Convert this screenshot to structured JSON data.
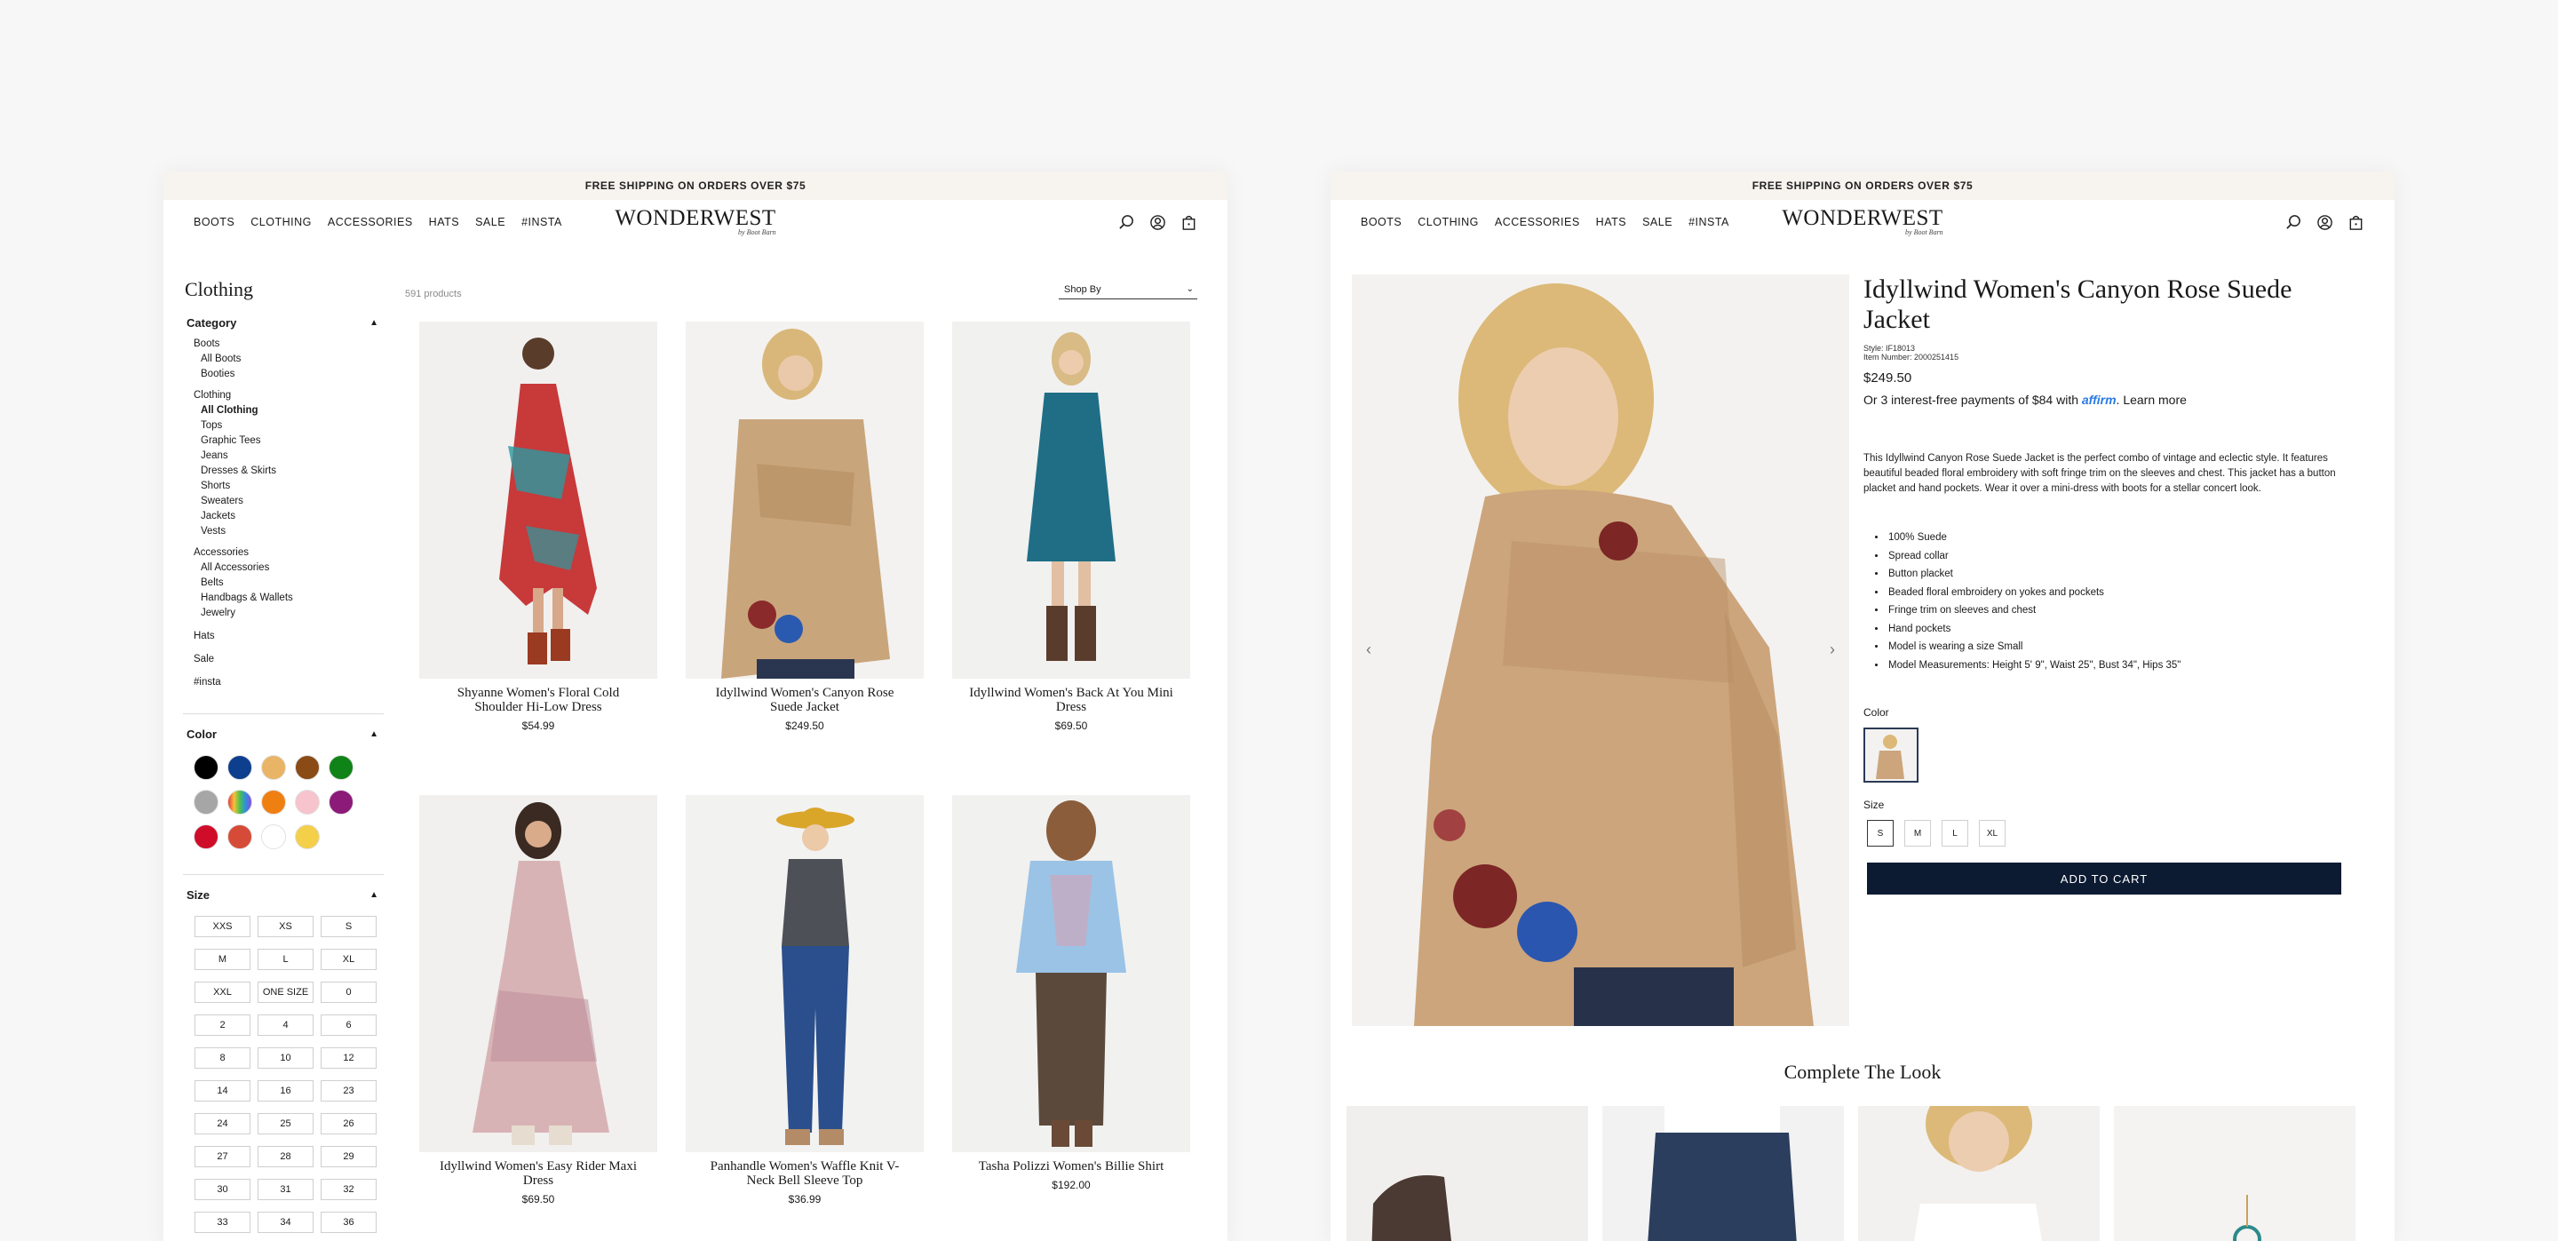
{
  "banner": "FREE SHIPPING ON ORDERS OVER $75",
  "nav": [
    "BOOTS",
    "CLOTHING",
    "ACCESSORIES",
    "HATS",
    "SALE",
    "#INSTA"
  ],
  "logo": {
    "main": "WONDERWEST",
    "sub": "by Boot Barn"
  },
  "icons": [
    "search-icon",
    "account-icon",
    "cart-icon"
  ],
  "listing": {
    "title": "Clothing",
    "count": "591 products",
    "sort_label": "Shop By",
    "category_label": "Category",
    "color_label": "Color",
    "size_label": "Size",
    "categories": {
      "boots": {
        "label": "Boots",
        "items": [
          "All Boots",
          "Booties"
        ]
      },
      "clothing": {
        "label": "Clothing",
        "items": [
          "All Clothing",
          "Tops",
          "Graphic Tees",
          "Jeans",
          "Dresses & Skirts",
          "Shorts",
          "Sweaters",
          "Jackets",
          "Vests"
        ]
      },
      "accessories": {
        "label": "Accessories",
        "items": [
          "All Accessories",
          "Belts",
          "Handbags & Wallets",
          "Jewelry"
        ]
      },
      "hats": "Hats",
      "sale": "Sale",
      "insta": "#insta"
    },
    "colors": [
      "#000000",
      "#0e3f8e",
      "#e9b466",
      "#8a4b16",
      "#108318",
      "#a6a6a6",
      "rainbow",
      "#f07f12",
      "#f7c3cc",
      "#8c1a78",
      "#cf0d2b",
      "#d64b37",
      "#ffffff",
      "#f4cf4a"
    ],
    "sizes": [
      "XXS",
      "XS",
      "S",
      "M",
      "L",
      "XL",
      "XXL",
      "ONE SIZE",
      "0",
      "2",
      "4",
      "6",
      "8",
      "10",
      "12",
      "14",
      "16",
      "23",
      "24",
      "25",
      "26",
      "27",
      "28",
      "29",
      "30",
      "31",
      "32",
      "33",
      "34",
      "36"
    ],
    "products": [
      {
        "name": "Shyanne Women's Floral Cold Shoulder Hi-Low Dress",
        "price": "$54.99"
      },
      {
        "name": "Idyllwind Women's Canyon Rose Suede Jacket",
        "price": "$249.50"
      },
      {
        "name": "Idyllwind Women's Back At You Mini Dress",
        "price": "$69.50"
      },
      {
        "name": "Idyllwind Women's Easy Rider Maxi Dress",
        "price": "$69.50"
      },
      {
        "name": "Panhandle Women's Waffle Knit V-Neck Bell Sleeve Top",
        "price": "$36.99"
      },
      {
        "name": "Tasha Polizzi Women's Billie Shirt",
        "price": "$192.00"
      }
    ]
  },
  "pdp": {
    "title": "Idyllwind Women's Canyon Rose Suede Jacket",
    "style": "Style: IF18013",
    "item_number": "Item Number: 2000251415",
    "price": "$249.50",
    "affirm_text": "Or 3 interest-free payments of $84 with",
    "affirm_brand": "affirm",
    "affirm_link": "Learn more",
    "description": "This Idyllwind Canyon Rose Suede Jacket is the perfect combo of vintage and eclectic style. It features beautiful beaded floral embroidery with soft fringe trim on the sleeves and chest. This jacket has a button placket and hand pockets. Wear it over a mini-dress with boots for a stellar concert look.",
    "features": [
      "100% Suede",
      "Spread collar",
      "Button placket",
      "Beaded floral embroidery on yokes and pockets",
      "Fringe trim on sleeves and chest",
      "Hand pockets",
      "Model is wearing a size Small",
      "Model Measurements: Height 5' 9\", Waist 25\", Bust 34\", Hips 35\""
    ],
    "color_label": "Color",
    "size_label": "Size",
    "sizes": [
      "S",
      "M",
      "L",
      "XL"
    ],
    "selected_size": "S",
    "cta": "ADD TO CART",
    "prev_arrow": "‹",
    "next_arrow": "›",
    "complete_look": "Complete The Look"
  }
}
